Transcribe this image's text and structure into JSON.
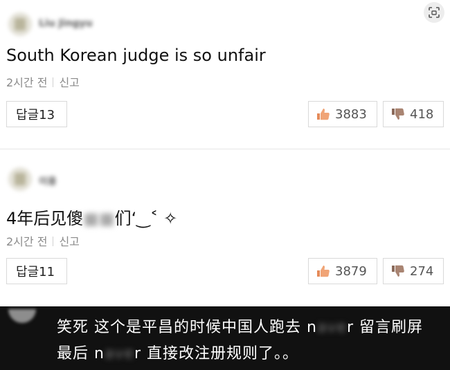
{
  "comments": [
    {
      "username": "Liu Jingyu",
      "text": "South Korean judge is so unfair",
      "time": "2시간 전",
      "report": "신고",
      "reply_label": "답글13",
      "likes": "3883",
      "dislikes": "418"
    },
    {
      "username": "이용",
      "text_before": "4年后见傻",
      "text_blurred": "■■",
      "text_after": "们‘‿˂ ✧",
      "time": "2시간 전",
      "report": "신고",
      "reply_label": "답글11",
      "likes": "3879",
      "dislikes": "274"
    }
  ],
  "caption": {
    "line1_before": "笑死 这个是平昌的时候中国人跑去 n",
    "line1_blurred": "ave",
    "line1_after": "r 留言刷屏",
    "line2_before": "最后 n",
    "line2_blurred": "ave",
    "line2_after": "r 直接改注册规则了。。"
  },
  "icons": {
    "corner": "screenshot-icon",
    "like": "thumbs-up-icon",
    "dislike": "thumbs-down-icon"
  },
  "colors": {
    "like_icon": "#e58b5a",
    "caption_bg": "#111111"
  }
}
